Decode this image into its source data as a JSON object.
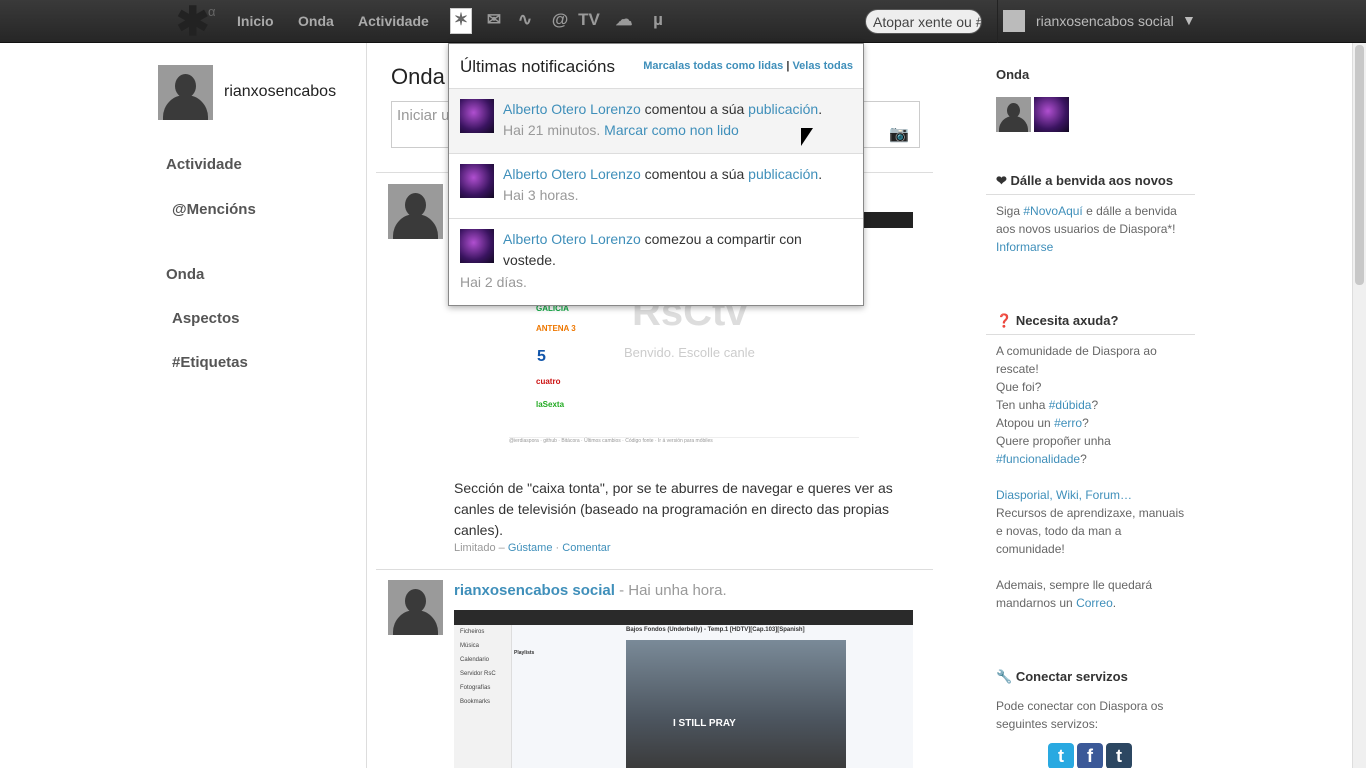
{
  "topbar": {
    "logo_alpha": "α",
    "nav": [
      "Inicio",
      "Onda",
      "Actividade"
    ],
    "icons": [
      {
        "name": "notifications-icon",
        "glyph": "✶"
      },
      {
        "name": "mail-icon",
        "glyph": "✉"
      },
      {
        "name": "activity-icon",
        "glyph": "∿"
      },
      {
        "name": "mentions-icon",
        "glyph": "@"
      },
      {
        "name": "tv-icon",
        "glyph": "TV"
      },
      {
        "name": "cloud-icon",
        "glyph": "☁"
      },
      {
        "name": "mu-icon",
        "glyph": "µ"
      }
    ],
    "search_placeholder": "Atopar xente ou #",
    "user_name": "rianxosencabos social",
    "user_caret": "▼"
  },
  "left": {
    "profile_name": "rianxosencabos",
    "items": [
      "Actividade",
      "@Mencións",
      "Onda",
      "Aspectos",
      "#Etiquetas"
    ]
  },
  "stream": {
    "title": "Onda",
    "publisher_placeholder": "Iniciar u",
    "camera_icon": "📷",
    "post1": {
      "screenshot_title": "RsCtv",
      "screenshot_subtitle": "Benvido. Escolle canle",
      "channels": [
        "GALICIA",
        "ANTENA 3",
        "5",
        "cuatro",
        "laSexta"
      ],
      "footer": "@ierdiaspora · github · Bitácora · Últimos cambios · Código fonte · Ir á versión para móbiles",
      "text": "Sección de \"caixa tonta\", por se te aburres de navegar e queres ver as canles de televisión (baseado na programación en directo das propias canles).",
      "meta_prefix": "Limitado –",
      "like": "Gústame",
      "dot": "·",
      "comment": "Comentar"
    },
    "post2": {
      "author": "rianxosencabos social",
      "time": "- Hai unha hora.",
      "sidebar": [
        "Ficheiros",
        "Música",
        "Calendario",
        "Servidor RsC",
        "Fotografías",
        "Bookmarks"
      ],
      "video_title": "Bajos Fondos (Underbelly) - Temp.1 [HDTV][Cap.103][Spanish]",
      "video_text": "I STILL PRAY",
      "playlist": "Playlists"
    }
  },
  "notifications": {
    "title": "Últimas notificacións",
    "mark_all": "Marcalas todas como lidas",
    "separator": "|",
    "see_all": "Velas todas",
    "items": [
      {
        "author": "Alberto Otero Lorenzo",
        "action": "comentou a súa",
        "target": "publicación",
        "period": ".",
        "time": "Hai 21 minutos.",
        "mark": "Marcar como non lido"
      },
      {
        "author": "Alberto Otero Lorenzo",
        "action": "comentou a súa",
        "target": "publicación",
        "period": ".",
        "time": "Hai 3 horas."
      },
      {
        "author": "Alberto Otero Lorenzo",
        "action": "comezou a compartir con vostede.",
        "time": "Hai 2 días."
      }
    ]
  },
  "right": {
    "onda_title": "Onda",
    "welcome_title": "Dálle a benvida aos novos",
    "welcome_text_1": "Siga",
    "welcome_tag": "#NovoAquí",
    "welcome_text_2": "e dálle a benvida aos novos usuarios de Diaspora*!",
    "welcome_link": "Informarse",
    "help_title": "Necesita axuda?",
    "help_line1": "A comunidade de Diaspora ao rescate!",
    "help_line2": "Que foi?",
    "help_line3a": "Ten unha",
    "help_tag1": "#dúbida",
    "help_line3b": "?",
    "help_line4a": "Atopou un",
    "help_tag2": "#erro",
    "help_line4b": "?",
    "help_line5": "Quere propoñer unha",
    "help_tag3": "#funcionalidade",
    "help_line5b": "?",
    "help_links": "Diasporial, Wiki, Forum…",
    "help_text2": "Recursos de aprendizaxe, manuais e novas, todo da man a comunidade!",
    "help_text3a": "Ademais, sempre lle quedará mandarnos un",
    "help_mail": "Correo",
    "help_text3b": ".",
    "connect_title": "Conectar servizos",
    "connect_text": "Pode conectar con Diaspora os seguintes servizos:",
    "services": [
      "t",
      "f",
      "t"
    ]
  }
}
